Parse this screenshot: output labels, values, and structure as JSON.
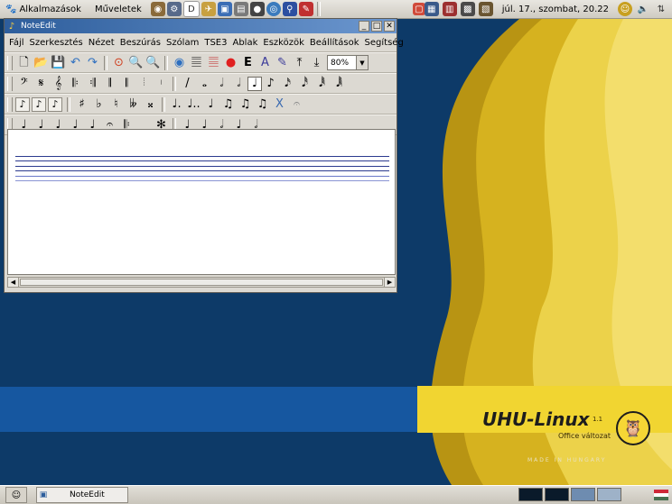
{
  "top_panel": {
    "applications_label": "Alkalmazások",
    "actions_label": "Műveletek",
    "launcher_icons": [
      "gimp-icon",
      "tools-icon",
      "document-icon",
      "picture-icon",
      "chat-icon",
      "photo-icon",
      "image-viewer-icon",
      "web-icon",
      "search-icon",
      "pen-icon"
    ],
    "clock": "júl. 17., szombat, 20.22",
    "tray_icons": [
      "network-icon",
      "book-icon",
      "calculator-icon",
      "notes-icon",
      "chat-icon",
      "volume-icon",
      "network-monitor-icon"
    ]
  },
  "window": {
    "title": "NoteEdit",
    "menu": [
      "Fájl",
      "Szerkesztés",
      "Nézet",
      "Beszúrás",
      "Szólam",
      "TSE3",
      "Ablak",
      "Eszközök",
      "Beállítások",
      "Segítség"
    ],
    "toolbar1": {
      "zoom_value": "80%",
      "glyphs": [
        "🗋",
        "📂",
        "💾",
        "↶",
        "↷",
        "⊙",
        "🔍",
        "🔍",
        "◉",
        "𝄚",
        "𝄚",
        "●",
        "E",
        "A",
        "✎",
        "⤒",
        "⤓"
      ]
    },
    "toolbar2_glyphs": [
      "𝄢",
      "𝄋",
      "𝄞",
      "𝄆",
      "𝄇",
      "𝄂",
      "𝄃",
      "𝄄",
      "𝄅",
      "/",
      "𝅝",
      "𝅗𝅥",
      "𝅗𝅥",
      "♩",
      "♪",
      "𝅘𝅥𝅯",
      "𝅘𝅥𝅰",
      "𝅘𝅥𝅱",
      "𝅘𝅥𝅲"
    ],
    "toolbar3_glyphs": [
      "♪",
      "♪",
      "♪",
      "♯",
      "♭",
      "♮",
      "𝄫",
      "𝄪",
      "♩.",
      "♩..",
      "♩",
      "♫",
      "♫",
      "♫",
      "X",
      "𝄐"
    ],
    "toolbar4_glyphs": [
      "♩",
      "♩",
      "♩",
      "♩",
      "♩",
      "𝄐",
      "𝄆",
      "𝆂",
      "✻",
      "♩",
      "♩",
      "𝅗𝅥",
      "♩",
      "𝅗𝅥"
    ]
  },
  "desktop": {
    "brand_title": "UHU-Linux",
    "brand_version": "1.1",
    "brand_subtitle": "Office változat",
    "brand_made": "MADE IN HUNGARY"
  },
  "bottom_panel": {
    "task_label": "NoteEdit"
  }
}
